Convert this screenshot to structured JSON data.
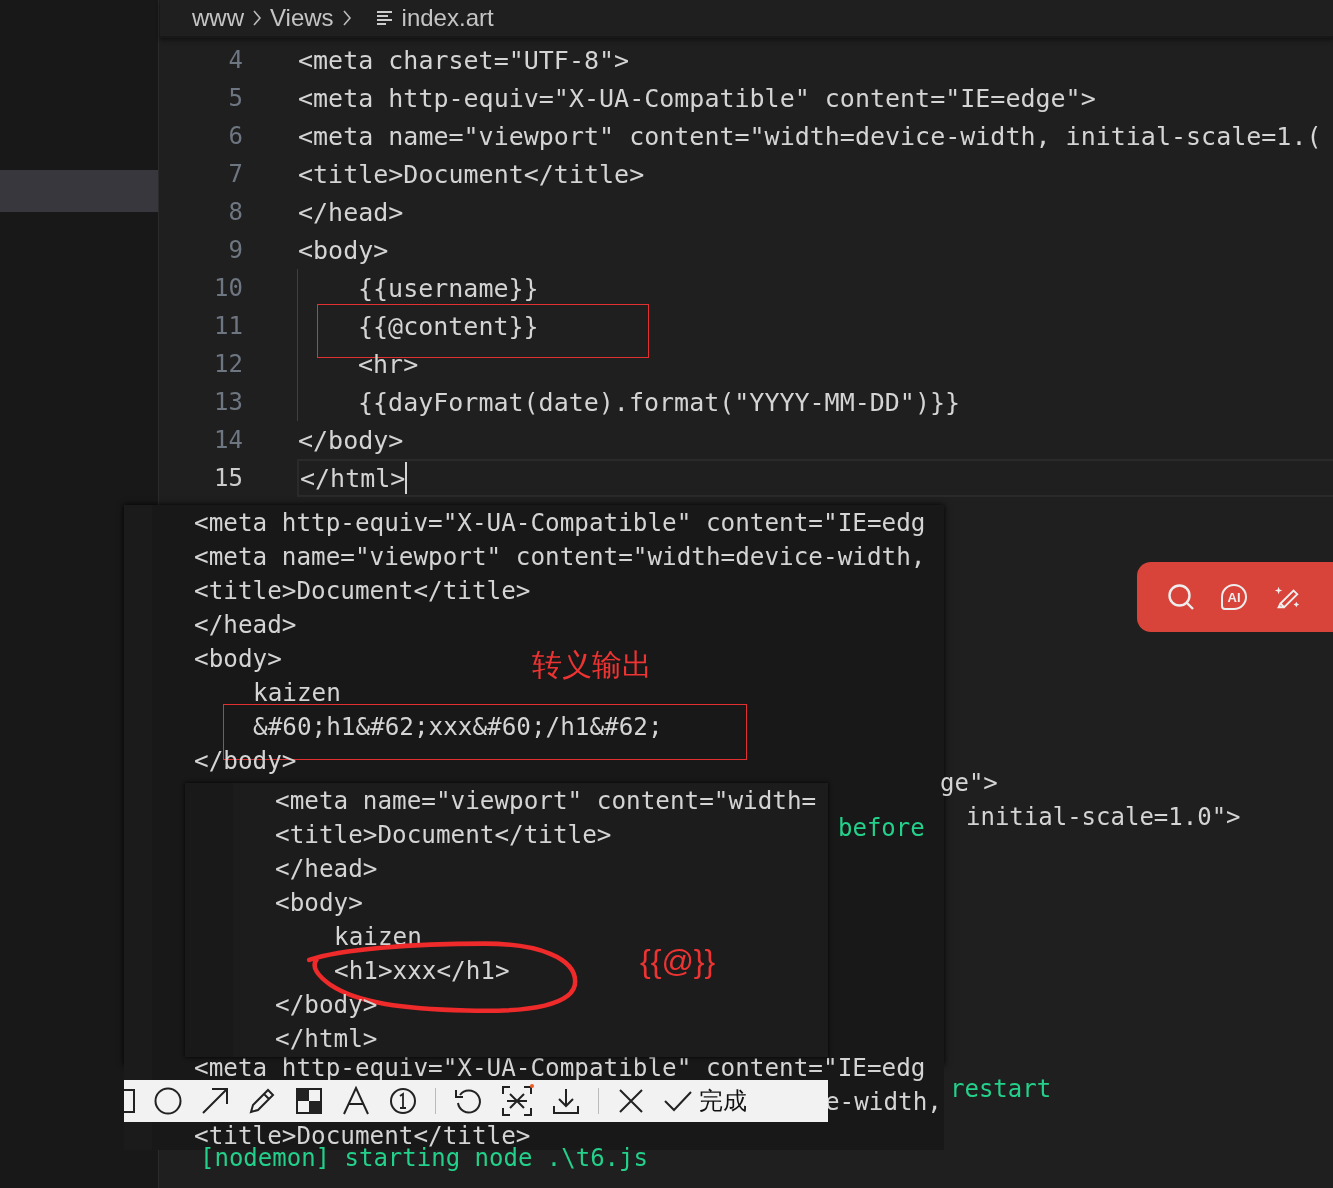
{
  "breadcrumb": {
    "items": [
      "www",
      "Views"
    ],
    "file": "index.art"
  },
  "editor": {
    "lines": [
      {
        "number": "4",
        "code": "<meta charset=\"UTF-8\">",
        "indented": false,
        "boxed": false,
        "current": false
      },
      {
        "number": "5",
        "code": "<meta http-equiv=\"X-UA-Compatible\" content=\"IE=edge\">",
        "indented": false,
        "boxed": false,
        "current": false
      },
      {
        "number": "6",
        "code": "<meta name=\"viewport\" content=\"width=device-width, initial-scale=1.(",
        "indented": false,
        "boxed": false,
        "current": false
      },
      {
        "number": "7",
        "code": "<title>Document</title>",
        "indented": false,
        "boxed": false,
        "current": false
      },
      {
        "number": "8",
        "code": "</head>",
        "indented": false,
        "boxed": false,
        "current": false
      },
      {
        "number": "9",
        "code": "<body>",
        "indented": false,
        "boxed": false,
        "current": false
      },
      {
        "number": "10",
        "code": "{{username}}",
        "indented": true,
        "boxed": false,
        "current": false
      },
      {
        "number": "11",
        "code": "{{@content}}",
        "indented": true,
        "boxed": true,
        "current": false
      },
      {
        "number": "12",
        "code": "<hr>",
        "indented": true,
        "boxed": false,
        "current": false
      },
      {
        "number": "13",
        "code": "{{dayFormat(date).format(\"YYYY-MM-DD\")}}",
        "indented": true,
        "boxed": false,
        "current": false
      },
      {
        "number": "14",
        "code": "</body>",
        "indented": false,
        "boxed": false,
        "current": false
      },
      {
        "number": "15",
        "code": "</html>",
        "indented": false,
        "boxed": false,
        "current": true
      }
    ]
  },
  "background_fragments": [
    {
      "kind": "code",
      "text": "ge\">"
    },
    {
      "kind": "code",
      "text": "initial-scale=1.0\">"
    },
    {
      "kind": "terminal",
      "text": "before"
    },
    {
      "kind": "terminal",
      "text": "restart"
    },
    {
      "kind": "terminal",
      "text": "[nodemon] starting  node .\\t6.js"
    }
  ],
  "escaped_output": {
    "lines": [
      {
        "code": "<meta http-equiv=\"X-UA-Compatible\" content=\"IE=edg",
        "indented": false,
        "boxed": false
      },
      {
        "code": "<meta name=\"viewport\" content=\"width=device-width,",
        "indented": false,
        "boxed": false
      },
      {
        "code": "<title>Document</title>",
        "indented": false,
        "boxed": false
      },
      {
        "code": "</head>",
        "indented": false,
        "boxed": false
      },
      {
        "code": "<body>",
        "indented": false,
        "boxed": false
      },
      {
        "code": "kaizen",
        "indented": true,
        "boxed": false
      },
      {
        "code": "&#60;h1&#62;xxx&#60;/h1&#62;",
        "indented": true,
        "boxed": true
      },
      {
        "code": "</body>",
        "indented": false,
        "boxed": false
      }
    ],
    "note": "转义输出"
  },
  "raw_output": {
    "lines": [
      {
        "code": "<meta name=\"viewport\" content=\"width=",
        "indented": false,
        "circled": false
      },
      {
        "code": "<title>Document</title>",
        "indented": false,
        "circled": false
      },
      {
        "code": "</head>",
        "indented": false,
        "circled": false
      },
      {
        "code": "<body>",
        "indented": false,
        "circled": false
      },
      {
        "code": "kaizen",
        "indented": true,
        "circled": false
      },
      {
        "code": "<h1>xxx</h1>",
        "indented": true,
        "circled": true
      },
      {
        "code": "</body>",
        "indented": false,
        "circled": false
      },
      {
        "code": "</html>",
        "indented": false,
        "circled": false
      }
    ],
    "note": "{{@}}"
  },
  "lower_snippet": {
    "lines": [
      "<meta http-equiv=\"X-UA-Compatible\" content=\"IE=edg",
      "e-width,",
      "<title>Document</title>"
    ]
  },
  "float_bar": {
    "ai_label": "AI"
  },
  "capture_toolbar": {
    "tools": [
      {
        "kind": "rectangle"
      },
      {
        "kind": "circle"
      },
      {
        "kind": "arrow"
      },
      {
        "kind": "pencil"
      },
      {
        "kind": "mosaic"
      },
      {
        "kind": "text"
      },
      {
        "kind": "number"
      },
      {
        "kind": "separator"
      },
      {
        "kind": "undo"
      },
      {
        "kind": "ocr"
      },
      {
        "kind": "download"
      },
      {
        "kind": "separator"
      },
      {
        "kind": "close"
      }
    ],
    "done": "完成"
  }
}
